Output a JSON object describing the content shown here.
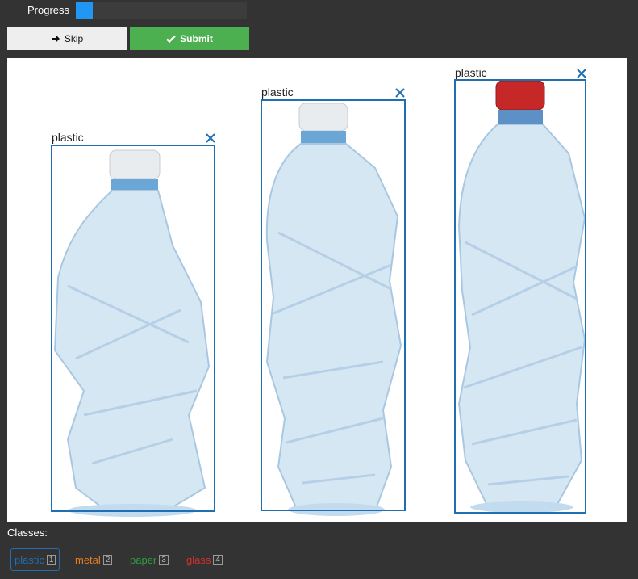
{
  "progress": {
    "label": "Progress",
    "value": 0.1
  },
  "toolbar": {
    "skip_label": "Skip",
    "submit_label": "Submit"
  },
  "annotations": [
    {
      "label": "plastic"
    },
    {
      "label": "plastic"
    },
    {
      "label": "plastic"
    }
  ],
  "classes": {
    "title": "Classes:",
    "items": [
      {
        "label": "plastic",
        "key": "1",
        "color": "#1f6fb2",
        "selected": true
      },
      {
        "label": "metal",
        "key": "2",
        "color": "#e67e22",
        "selected": false
      },
      {
        "label": "paper",
        "key": "3",
        "color": "#2e9e3e",
        "selected": false
      },
      {
        "label": "glass",
        "key": "4",
        "color": "#d32f2f",
        "selected": false
      }
    ]
  },
  "colors": {
    "accent": "#2196f3",
    "submit": "#4caf50",
    "bbox": "#1f6fb2",
    "cap_white": "#e8ecef",
    "cap_red": "#c62828"
  }
}
